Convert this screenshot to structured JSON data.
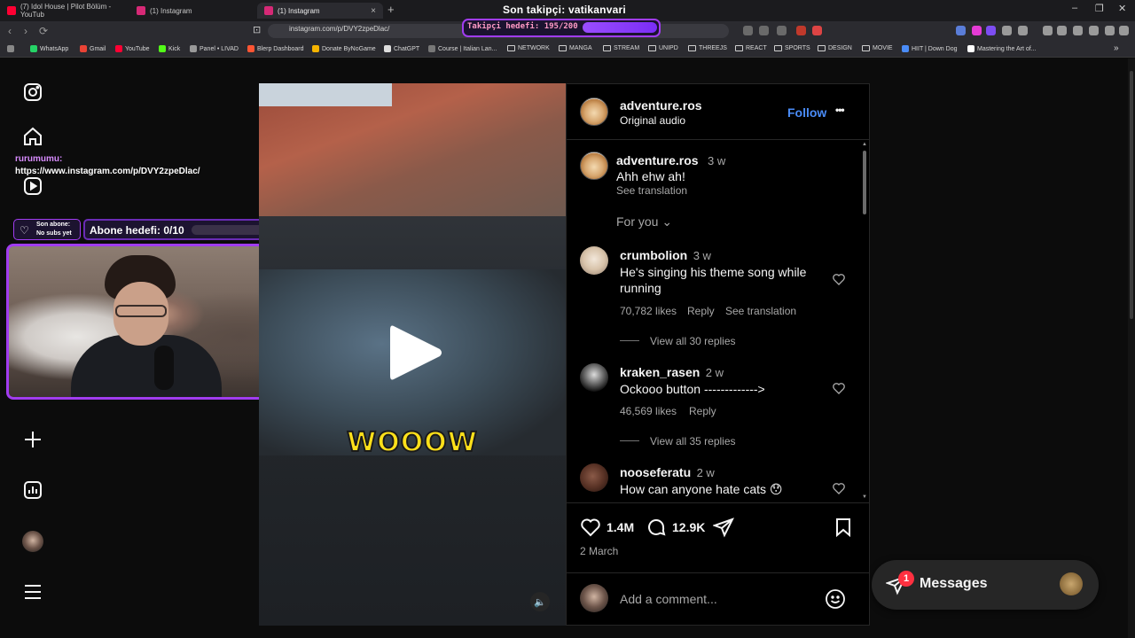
{
  "browser": {
    "tabs": [
      {
        "label": "(7) Idol House | Pilot Bölüm - YouTub",
        "color": "#ff0033"
      },
      {
        "label": "(1) Instagram",
        "color": "#d62976"
      },
      {
        "label": "(1) Instagram",
        "color": "#d62976"
      }
    ],
    "new_tab": "+",
    "close": "×",
    "window_controls": [
      "–",
      "❐",
      "✕"
    ],
    "nav": [
      "‹",
      "›",
      "⟳"
    ],
    "bookmark_glyph": "⊡",
    "url": "instagram.com/p/DVY2zpeDlac/",
    "bookmarks": [
      "WhatsApp",
      "Gmail",
      "YouTube",
      "Kick",
      "Panel • LIVAD",
      "Blerp Dashboard",
      "Donate ByNoGame",
      "ChatGPT",
      "Course | Italian Lan...",
      "NETWORK",
      "MANGA",
      "STREAM",
      "UNIPD",
      "THREEJS",
      "REACT",
      "SPORTS",
      "DESIGN",
      "MOVIE",
      "HIIT | Down Dog",
      "Mastering the Art of..."
    ],
    "bookmarks_more": "»"
  },
  "stream_overlay": {
    "follower_title": "Son takipçi: vatikanvari",
    "follower_goal": "Takipçi hedefi: 195/200",
    "follower_goal_progress": 0.975,
    "chat_user": "rurumumu:",
    "chat_message": "https://www.instagram.com/p/DVY2zpeDlac/",
    "heart_glyph": "♡",
    "sub_label_1": "Son abone:",
    "sub_label_2": "No subs yet",
    "sub_goal": "Abone hedefi: 0/10",
    "sub_goal_progress": 0.0
  },
  "post": {
    "caption_overlay": "WOOOW",
    "mute_glyph": "🔈",
    "author": "adventure.ros",
    "audio": "Original audio",
    "follow": "Follow",
    "more": "•••",
    "author_comment": {
      "user": "adventure.ros",
      "time": "3 w",
      "text": "Ahh ehw ah!",
      "translate": "See translation"
    },
    "sort_label": "For you",
    "sort_chevron": "⌄",
    "comments": [
      {
        "user": "crumbolion",
        "time": "3 w",
        "text_line1": "He's singing his theme song while",
        "text_line2": "running",
        "likes": "70,782 likes",
        "reply": "Reply",
        "translate": "See translation",
        "replies": "View all 30 replies"
      },
      {
        "user": "kraken_rasen",
        "time": "2 w",
        "text_line1": "Ockooo button ------------->",
        "likes": "46,569 likes",
        "reply": "Reply",
        "replies": "View all 35 replies"
      },
      {
        "user": "nooseferatu",
        "time": "2 w",
        "text_line1": "How can anyone hate cats 😯"
      }
    ],
    "likes_count": "1.4M",
    "comments_count": "12.9K",
    "date": "2 March",
    "comment_placeholder": "Add a comment..."
  },
  "messages": {
    "label": "Messages",
    "badge": "1"
  },
  "colors": {
    "accent": "#a13cf0",
    "follow": "#4a8cf7",
    "badge": "#ff3040",
    "goal_text": "#ff9ac6",
    "wow": "#ffe01a"
  }
}
